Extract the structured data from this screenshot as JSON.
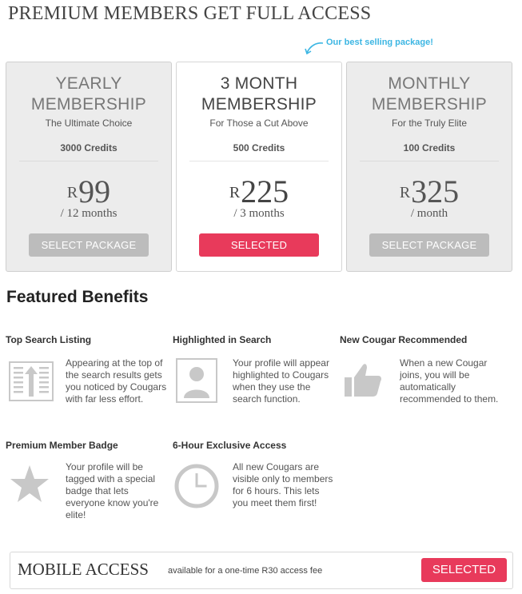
{
  "header": {
    "title": "PREMIUM MEMBERS GET FULL ACCESS",
    "best_note": "Our best selling package!"
  },
  "packages": [
    {
      "title_line1": "YEARLY",
      "title_line2": "MEMBERSHIP",
      "subtitle": "The Ultimate Choice",
      "credits": "3000 Credits",
      "currency": "R",
      "price": "99",
      "period": "/ 12 months",
      "button": "SELECT PACKAGE"
    },
    {
      "title_line1": "3 MONTH",
      "title_line2": "MEMBERSHIP",
      "subtitle": "For Those a Cut Above",
      "credits": "500 Credits",
      "currency": "R",
      "price": "225",
      "period": "/ 3 months",
      "button": "SELECTED"
    },
    {
      "title_line1": "MONTHLY",
      "title_line2": "MEMBERSHIP",
      "subtitle": "For the Truly Elite",
      "credits": "100 Credits",
      "currency": "R",
      "price": "325",
      "period": "/ month",
      "button": "SELECT PACKAGE"
    }
  ],
  "benefits": {
    "title": "Featured Benefits",
    "items": [
      {
        "title": "Top Search Listing",
        "desc": "Appearing at the top of the search results gets you noticed by Cougars with far less effort.",
        "icon": "top-listing-icon"
      },
      {
        "title": "Highlighted in Search",
        "desc": "Your profile will appear highlighted to Cougars when they use the search function.",
        "icon": "profile-highlight-icon"
      },
      {
        "title": "New Cougar Recommended",
        "desc": "When a new Cougar joins, you will be automatically recommended to them.",
        "icon": "thumbs-up-icon"
      },
      {
        "title": "Premium Member Badge",
        "desc": "Your profile will be tagged with a special badge that lets everyone know you're elite!",
        "icon": "star-icon"
      },
      {
        "title": "6-Hour Exclusive Access",
        "desc": "All new Cougars are visible only to members for 6 hours. This lets you meet them first!",
        "icon": "clock-icon"
      }
    ]
  },
  "mobile": {
    "title": "MOBILE ACCESS",
    "note": "available for a one-time R30 access fee",
    "button": "SELECTED"
  },
  "colors": {
    "accent": "#e83a5b",
    "note": "#3cb6e3",
    "button_default": "#bcbcbc",
    "card_bg": "#ececec"
  }
}
